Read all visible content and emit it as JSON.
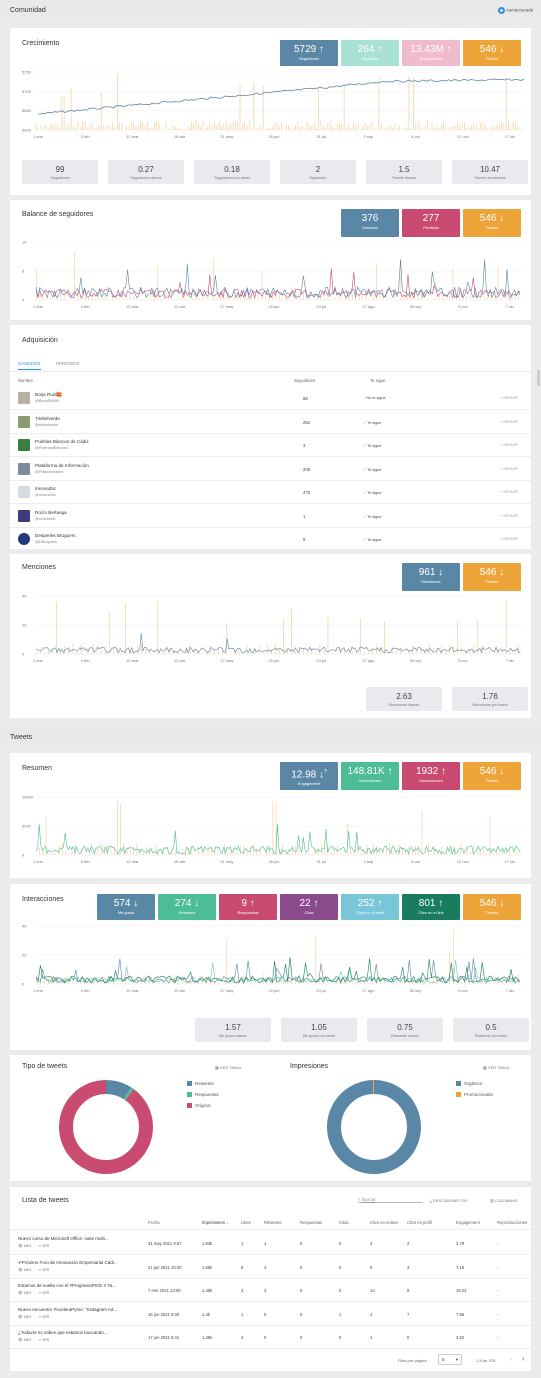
{
  "comunidad": {
    "title": "Comunidad",
    "account": "zamarzazade",
    "crecimiento": {
      "title": "Crecimiento",
      "kpis": [
        {
          "value": "5729 ↑",
          "label": "Seguidores",
          "color": "#5b87a7"
        },
        {
          "value": "264 ↑",
          "label": "Seguidos",
          "color": "#a9e2d5"
        },
        {
          "value": "13.43M ↑",
          "label": "Engagement",
          "color": "#f0bccb"
        },
        {
          "value": "546 ↓",
          "label": "Tweets",
          "color": "#eda53a"
        }
      ],
      "y_ticks": [
        "5750",
        "5700",
        "5650",
        "5600"
      ],
      "x_ticks": [
        "1 ene",
        "3 feb",
        "12 mar",
        "16 abr",
        "21 may",
        "26 jun",
        "31 jul",
        "3 sep",
        "8 oct",
        "12 nov",
        "17 dic"
      ],
      "stats": [
        {
          "value": "99",
          "label": "Seguidores"
        },
        {
          "value": "0.27",
          "label": "Seguidores diarios"
        },
        {
          "value": "0.18",
          "label": "Seguidores por tweet"
        },
        {
          "value": "2",
          "label": "Siguiendo"
        },
        {
          "value": "1.5",
          "label": "Tweets diarios"
        },
        {
          "value": "10.47",
          "label": "Tweets semanales"
        }
      ]
    },
    "balance": {
      "title": "Balance de seguidores",
      "kpis": [
        {
          "value": "376",
          "label": "Ganados",
          "color": "#5b87a7"
        },
        {
          "value": "277",
          "label": "Perdidos",
          "color": "#c94b72"
        },
        {
          "value": "546 ↓",
          "label": "Tweets",
          "color": "#eda53a"
        }
      ],
      "y_ticks": [
        "10",
        "5",
        "0"
      ],
      "x_ticks": [
        "1 ene",
        "4 feb",
        "10 mar",
        "13 abr",
        "17 may",
        "20 jun",
        "24 jul",
        "27 ago",
        "30 sep",
        "3 nov",
        "7 dic"
      ]
    },
    "adquisicion": {
      "title": "Adquisición",
      "tabs": [
        "GANADOS",
        "PERDIDOS"
      ],
      "headers": [
        "Nombre",
        "Seguidores",
        "Te sigue"
      ],
      "rows": [
        {
          "name": "Borja Ruiz🇪🇸",
          "handle": "@BorjaR8089",
          "followers": "58",
          "follows": "No te sigue",
          "check": false,
          "btn": "SEGUIR",
          "av": "#b9b2a4"
        },
        {
          "name": "Triskelverde",
          "handle": "@triskelverde",
          "followers": "252",
          "follows": "Te sigue",
          "check": true,
          "btn": "SEGUIR",
          "av": "#8a9b6f"
        },
        {
          "name": "Pueblos Blancos de Cádiz",
          "handle": "@PueblosBlancosC",
          "followers": "3",
          "follows": "Te sigue",
          "check": true,
          "btn": "SEGUIR",
          "av": "#3b7d43"
        },
        {
          "name": "Plataforma de Información",
          "handle": "@Plataformades",
          "followers": "208",
          "follows": "Te sigue",
          "check": true,
          "btn": "SEGUIR",
          "av": "#7f8b99"
        },
        {
          "name": "Innova2tic",
          "handle": "@innova2tic",
          "followers": "475",
          "follows": "Te sigue",
          "check": true,
          "btn": "SEGUIR",
          "av": "#d8dde4"
        },
        {
          "name": "Rocío Berlanga",
          "handle": "@rocioberlb",
          "followers": "1",
          "follows": "Te sigue",
          "check": true,
          "btn": "SEGUIR",
          "av": "#3f3c7c"
        },
        {
          "name": "Desperles Bruguers",
          "handle": "@DBruguers",
          "followers": "9",
          "follows": "Te sigue",
          "check": true,
          "btn": "SEGUIR",
          "av": "#223a7a"
        }
      ]
    },
    "menciones": {
      "title": "Menciones",
      "kpis": [
        {
          "value": "961 ↓",
          "label": "Menciones",
          "color": "#5b87a7"
        },
        {
          "value": "546 ↓",
          "label": "Tweets",
          "color": "#eda53a"
        }
      ],
      "y_ticks": [
        "40",
        "20",
        "0"
      ],
      "x_ticks": [
        "1 ene",
        "4 feb",
        "10 mar",
        "13 abr",
        "17 may",
        "20 jun",
        "24 jul",
        "27 ago",
        "30 sep",
        "3 nov",
        "7 dic"
      ],
      "stats": [
        {
          "value": "2.63",
          "label": "Menciones diarias"
        },
        {
          "value": "1.76",
          "label": "Menciones por tweet"
        }
      ]
    }
  },
  "tweets": {
    "title": "Tweets",
    "resumen": {
      "title": "Resumen",
      "kpis": [
        {
          "value": "12.98 ↓",
          "label": "Engagement",
          "color": "#5b87a7",
          "sup": "?"
        },
        {
          "value": "148.81K ↑",
          "label": "Impresiones",
          "color": "#4cbd95"
        },
        {
          "value": "1932 ↑",
          "label": "Interacciones",
          "color": "#c94b72"
        },
        {
          "value": "546 ↓",
          "label": "Tweets",
          "color": "#eda53a"
        }
      ],
      "y_ticks": [
        "10000",
        "5000",
        "0"
      ],
      "x_ticks": [
        "1 ene",
        "3 feb",
        "12 mar",
        "16 abr",
        "21 may",
        "26 jun",
        "31 jul",
        "3 sep",
        "8 oct",
        "12 nov",
        "17 dic"
      ]
    },
    "interacciones": {
      "title": "Interacciones",
      "kpis": [
        {
          "value": "574 ↓",
          "label": "Me gusta",
          "color": "#5b87a7"
        },
        {
          "value": "274 ↓",
          "label": "Retweets",
          "color": "#4cbd95"
        },
        {
          "value": "9 ↑",
          "label": "Respuestas",
          "color": "#c94b72"
        },
        {
          "value": "22 ↑",
          "label": "Citas",
          "color": "#8a4b8c"
        },
        {
          "value": "252 ↑",
          "label": "Clics en el perfil",
          "color": "#79c6d9"
        },
        {
          "value": "801 ↑",
          "label": "Clics en el link",
          "color": "#1a7c5e"
        },
        {
          "value": "546 ↓",
          "label": "Tweets",
          "color": "#eda53a"
        }
      ],
      "y_ticks": [
        "40",
        "20",
        "0"
      ],
      "x_ticks": [
        "1 ene",
        "4 feb",
        "10 mar",
        "13 abr",
        "17 may",
        "20 jun",
        "24 jul",
        "27 ago",
        "30 sep",
        "3 nov",
        "7 dic"
      ],
      "stats": [
        {
          "value": "1.57",
          "label": "Me gusta diarios"
        },
        {
          "value": "1.05",
          "label": "Me gusta por tweet"
        },
        {
          "value": "0.75",
          "label": "Retweets diarios"
        },
        {
          "value": "0.5",
          "label": "Retweets por tweet"
        }
      ]
    },
    "tipo": {
      "title": "Tipo de tweets",
      "table_btn": "VER TABLA",
      "legend": [
        {
          "label": "Retweets",
          "color": "#5b87a7",
          "value": 0.09
        },
        {
          "label": "Respuestas",
          "color": "#4cbd95",
          "value": 0.01
        },
        {
          "label": "Original",
          "color": "#c94b72",
          "value": 0.9
        }
      ]
    },
    "impresiones": {
      "title": "Impresiones",
      "table_btn": "VER TABLA",
      "legend": [
        {
          "label": "Orgánico",
          "color": "#5b87a7",
          "value": 0.995
        },
        {
          "label": "Promocionado",
          "color": "#eda53a",
          "value": 0.005
        }
      ]
    },
    "lista": {
      "title": "Lista de tweets",
      "search_placeholder": "Buscar",
      "download": "DESCARGAR CSV",
      "columns_btn": "COLUMNAS",
      "headers": [
        "Fecha",
        "Impresiones ↓",
        "Likes",
        "Retweets",
        "Respuestas",
        "Citas",
        "Clics en enlace",
        "Clics en perfil",
        "Engagement",
        "Reproducciones"
      ],
      "more": "MÁS",
      "view": "VER",
      "rows": [
        {
          "text": "Nuevo curso de Microsoft Office: suite multi...",
          "date": "31 may 2021 9:57",
          "imp": "1.83k",
          "likes": "1",
          "rt": "1",
          "resp": "0",
          "citas": "0",
          "enl": "3",
          "perf": "2",
          "eng": "3.79",
          "rep": "-"
        },
        {
          "text": "✔Próximo Foro de Innovación Empresarial Cádi...",
          "date": "21 jun 2021 15:30",
          "imp": "1.68k",
          "likes": "6",
          "rt": "3",
          "resp": "0",
          "citas": "0",
          "enl": "0",
          "perf": "3",
          "eng": "7.15",
          "rep": "-"
        },
        {
          "text": "Estamos de vuelta con el #ProgramaPICE !! Ya...",
          "date": "7 ene 2021 13:00",
          "imp": "1.48k",
          "likes": "3",
          "rt": "3",
          "resp": "0",
          "citas": "0",
          "enl": "14",
          "perf": "8",
          "eng": "19.22",
          "rep": "-"
        },
        {
          "text": "Nuevo encuentro #AceleraPyme: \"Instagram Ad...",
          "date": "15 jun 2021 9:30",
          "imp": "1.4k",
          "likes": "1",
          "rt": "0",
          "resp": "0",
          "citas": "1",
          "enl": "2",
          "perf": "7",
          "eng": "7.86",
          "rep": "-"
        },
        {
          "text": "¿Todavía no sabes que estamos buscando...",
          "date": "17 jun 2021 8:41",
          "imp": "1.38k",
          "likes": "4",
          "rt": "0",
          "resp": "0",
          "citas": "0",
          "enl": "1",
          "perf": "0",
          "eng": "3.62",
          "rep": "-"
        }
      ],
      "footer": {
        "rows_label": "Filas por página:",
        "rows_value": "5",
        "range": "1-5 de 378"
      }
    }
  }
}
